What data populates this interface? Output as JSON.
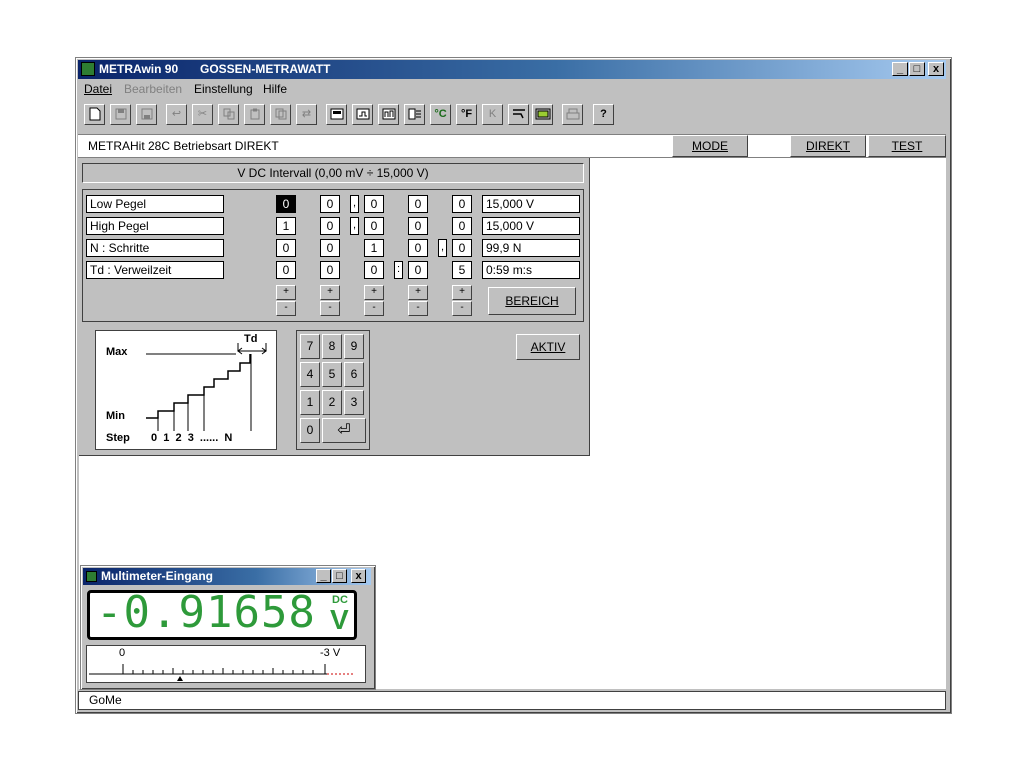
{
  "window": {
    "title_app": "METRAwin 90",
    "title_company": "GOSSEN-METRAWATT",
    "controls": [
      "_",
      "□",
      "x"
    ]
  },
  "menu": [
    {
      "label": "Datei",
      "enabled": true
    },
    {
      "label": "Bearbeiten",
      "enabled": false
    },
    {
      "label": "Einstellung",
      "enabled": true
    },
    {
      "label": "Hilfe",
      "enabled": true
    }
  ],
  "toolbar": {
    "celsius": "°C",
    "fahrenheit": "°F",
    "kelvin": "K",
    "help": "?"
  },
  "header": {
    "device_text": "METRAHit 28C  Betriebsart DIREKT",
    "mode_button": "MODE",
    "direkt_button": "DIREKT",
    "test_button": "TEST"
  },
  "panel": {
    "title": "V DC Intervall  (0,00 mV ÷ 15,000 V)",
    "rows": [
      {
        "label": "Low Pegel",
        "d": [
          "0",
          "0",
          "0",
          "0",
          "0"
        ],
        "seps": [
          ",",
          "",
          "",
          ""
        ],
        "value": "15,000 V"
      },
      {
        "label": "High Pegel",
        "d": [
          "1",
          "0",
          "0",
          "0",
          "0"
        ],
        "seps": [
          ",",
          "",
          "",
          ""
        ],
        "value": "15,000 V"
      },
      {
        "label": "N  : Schritte",
        "d": [
          "0",
          "0",
          "1",
          "0",
          "0"
        ],
        "seps": [
          "",
          "",
          ",",
          ""
        ],
        "value": "99,9 N"
      },
      {
        "label": "Td : Verweilzeit",
        "d": [
          "0",
          "0",
          "0",
          "0",
          "5"
        ],
        "seps": [
          "",
          ":",
          "",
          ""
        ],
        "value": "0:59 m:s"
      }
    ],
    "plus": "+",
    "minus": "-",
    "bereich_button": "BEREICH",
    "aktiv_button": "AKTIV"
  },
  "diagram": {
    "max": "Max",
    "min": "Min",
    "step": "Step",
    "td": "Td",
    "steps": "0  1  2  3  ......  N"
  },
  "keypad": {
    "keys": [
      "7",
      "8",
      "9",
      "4",
      "5",
      "6",
      "1",
      "2",
      "3",
      "0"
    ],
    "enter": "⏎"
  },
  "multimeter": {
    "title": "Multimeter-Eingang",
    "reading": "-0.91658",
    "coupling": "DC",
    "unit": "V",
    "scale_left": "0",
    "scale_right": "-3 V",
    "controls": [
      "_",
      "□",
      "x"
    ]
  },
  "status": {
    "text": "GoMe"
  },
  "colors": {
    "title_gradient_start": "#0a246a",
    "lcd_green": "#2e9a3a",
    "scale_red": "#cc0000"
  }
}
